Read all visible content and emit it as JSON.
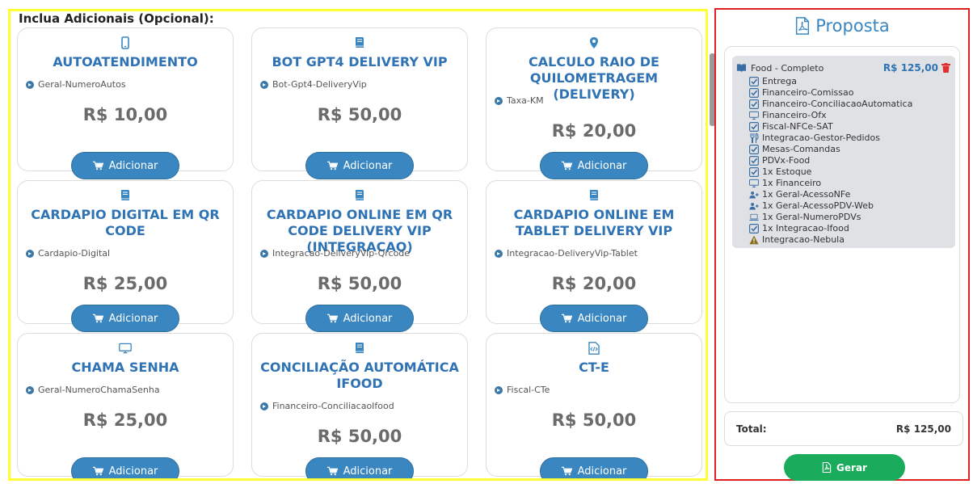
{
  "section_title": "Inclua Adicionais (Opcional):",
  "cards": [
    {
      "icon": "mobile-icon",
      "title": "AUTOATENDIMENTO",
      "code": "Geral-NumeroAutos",
      "price": "R$ 10,00",
      "button": "Adicionar"
    },
    {
      "icon": "book-icon",
      "title": "BOT GPT4 DELIVERY VIP",
      "code": "Bot-Gpt4-DeliveryVip",
      "price": "R$ 50,00",
      "button": "Adicionar"
    },
    {
      "icon": "map-marker-icon",
      "title": "CALCULO RAIO DE QUILOMETRAGEM (DELIVERY)",
      "code": "Taxa-KM",
      "price": "R$ 20,00",
      "button": "Adicionar"
    },
    {
      "icon": "book-icon",
      "title": "CARDAPIO DIGITAL EM QR CODE",
      "code": "Cardapio-Digital",
      "price": "R$ 25,00",
      "button": "Adicionar"
    },
    {
      "icon": "book-icon",
      "title": "CARDAPIO ONLINE EM QR CODE DELIVERY VIP (INTEGRACAO)",
      "code": "Integracao-DeliveryVip-Qrcode",
      "price": "R$ 50,00",
      "button": "Adicionar"
    },
    {
      "icon": "book-icon",
      "title": "CARDAPIO ONLINE EM TABLET DELIVERY VIP",
      "code": "Integracao-DeliveryVip-Tablet",
      "price": "R$ 20,00",
      "button": "Adicionar"
    },
    {
      "icon": "monitor-icon",
      "title": "CHAMA SENHA",
      "code": "Geral-NumeroChamaSenha",
      "price": "R$ 25,00",
      "button": "Adicionar"
    },
    {
      "icon": "book-icon",
      "title": "CONCILIAÇÃO AUTOMÁTICA IFOOD",
      "code": "Financeiro-ConciliacaoIfood",
      "price": "R$ 50,00",
      "button": "Adicionar"
    },
    {
      "icon": "code-file-icon",
      "title": "CT-E",
      "code": "Fiscal-CTe",
      "price": "R$ 50,00",
      "button": "Adicionar"
    }
  ],
  "proposta": {
    "title": "Proposta",
    "group": {
      "name": "Food - Completo",
      "price": "R$ 125,00",
      "items": [
        {
          "icon": "check-icon",
          "label": "Entrega"
        },
        {
          "icon": "check-icon",
          "label": "Financeiro-Comissao"
        },
        {
          "icon": "check-icon",
          "label": "Financeiro-ConciliacaoAutomatica"
        },
        {
          "icon": "monitor-icon",
          "label": "Financeiro-Ofx"
        },
        {
          "icon": "check-icon",
          "label": "Fiscal-NFCe-SAT"
        },
        {
          "icon": "cutlery-icon",
          "label": "Integracao-Gestor-Pedidos"
        },
        {
          "icon": "check-icon",
          "label": "Mesas-Comandas"
        },
        {
          "icon": "check-icon",
          "label": "PDVx-Food"
        },
        {
          "icon": "check-icon",
          "label": "1x Estoque"
        },
        {
          "icon": "monitor-icon",
          "label": "1x Financeiro"
        },
        {
          "icon": "user-plus-icon",
          "label": "1x Geral-AcessoNFe"
        },
        {
          "icon": "user-plus-icon",
          "label": "1x Geral-AcessoPDV-Web"
        },
        {
          "icon": "laptop-icon",
          "label": "1x Geral-NumeroPDVs"
        },
        {
          "icon": "check-icon",
          "label": "1x Integracao-Ifood"
        },
        {
          "icon": "warning-icon",
          "label": "Integracao-Nebula"
        }
      ]
    },
    "total_label": "Total:",
    "total_value": "R$ 125,00",
    "gerar_label": "Gerar"
  }
}
